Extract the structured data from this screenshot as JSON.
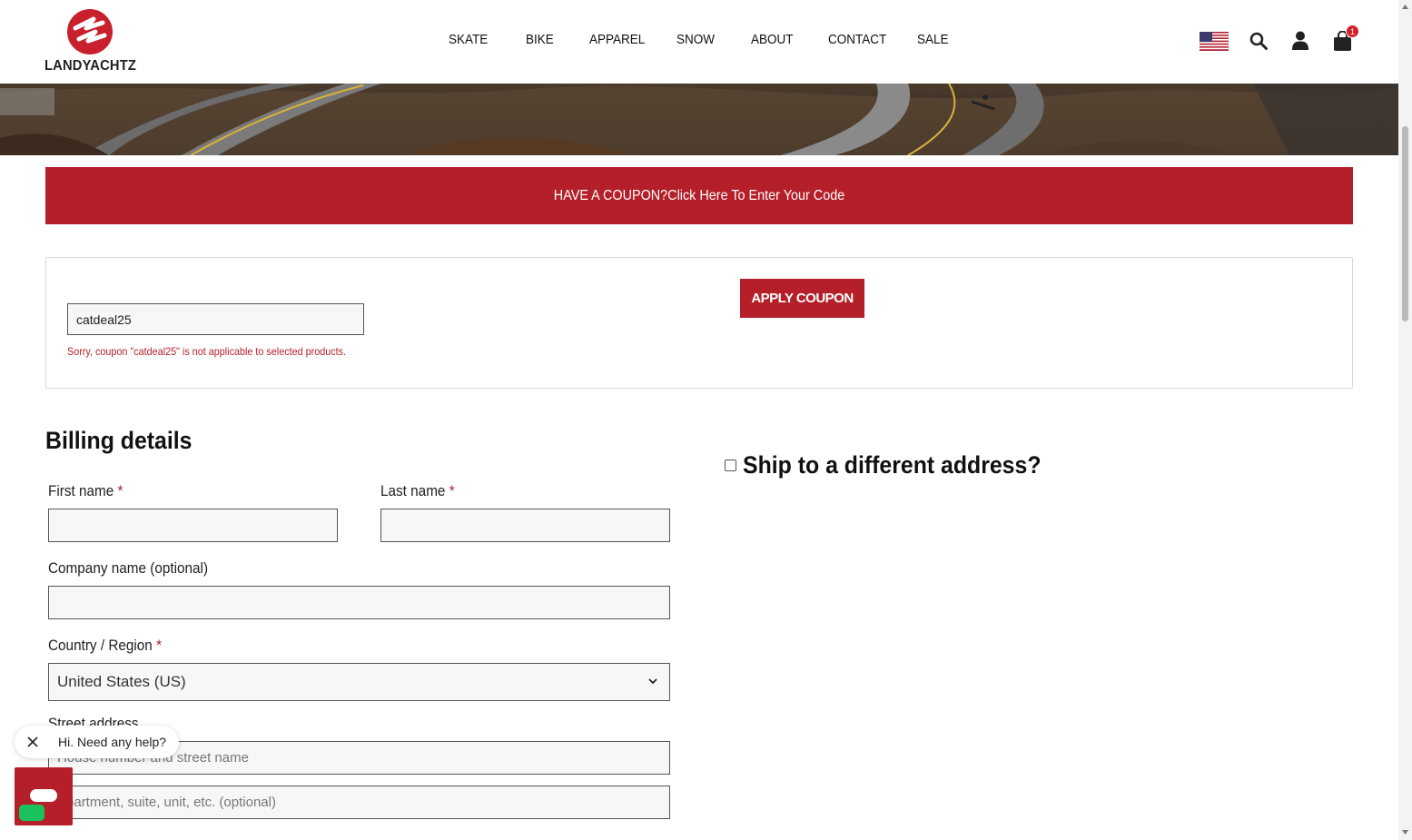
{
  "header": {
    "logo_text": "LANDYACHTZ",
    "nav": [
      "SKATE",
      "BIKE",
      "APPAREL",
      "SNOW",
      "ABOUT",
      "CONTACT",
      "SALE"
    ],
    "cart_count": "1"
  },
  "colors": {
    "brand_red": "#b51f29",
    "chat_green": "#19c25a"
  },
  "coupon_banner": {
    "text": "HAVE A COUPON?Click Here To Enter Your Code"
  },
  "coupon": {
    "value": "catdeal25",
    "error": "Sorry, coupon \"catdeal25\" is not applicable to selected products.",
    "apply_label": "APPLY COUPON"
  },
  "billing": {
    "title": "Billing details",
    "first_name_label": "First name",
    "last_name_label": "Last name",
    "company_label": "Company name (optional)",
    "country_label": "Country / Region",
    "country_value": "United States (US)",
    "street_label": "Street address",
    "street_placeholder": "House number and street name",
    "street2_placeholder": "Apartment, suite, unit, etc. (optional)",
    "required_mark": "*"
  },
  "shipping": {
    "label": "Ship to a different address?"
  },
  "chat": {
    "greeting": "Hi. Need any help?"
  },
  "icons": [
    "us-flag-icon",
    "search-icon",
    "user-icon",
    "cart-icon",
    "chevron-down-icon",
    "close-icon",
    "chat-icon"
  ]
}
